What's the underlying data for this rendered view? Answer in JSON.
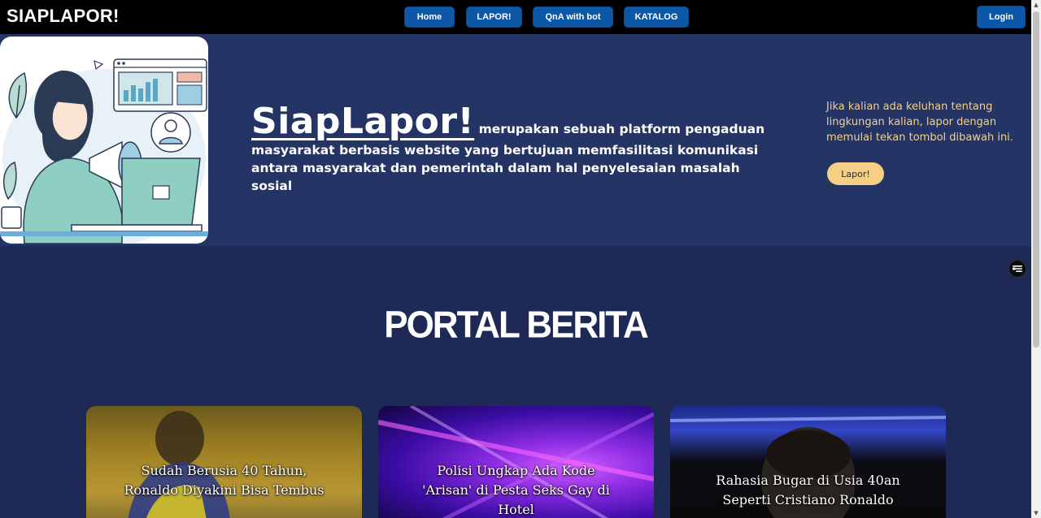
{
  "nav": {
    "brand": "SIAPLAPOR!",
    "items": [
      {
        "label": "Home"
      },
      {
        "label": "LAPOR!"
      },
      {
        "label": "QnA with bot"
      },
      {
        "label": "KATALOG"
      }
    ],
    "login_label": "Login"
  },
  "hero": {
    "title": "SiapLapor!",
    "description": "merupakan sebuah platform pengaduan masyarakat berbasis website yang bertujuan memfasilitasi komunikasi antara masyarakat dan pemerintah dalam hal penyelesaian masalah sosial",
    "side_text": "Jika kalian ada keluhan tentang lingkungan kalian, lapor dengan memulai tekan tombol dibawah ini.",
    "cta_label": "Lapor!"
  },
  "portal": {
    "title": "PORTAL BERITA",
    "cards": [
      {
        "title": "Sudah Berusia 40 Tahun, Ronaldo Diyakini Bisa Tembus"
      },
      {
        "title": "Polisi Ungkap Ada Kode 'Arisan' di Pesta Seks Gay di Hotel"
      },
      {
        "title": "Rahasia Bugar di Usia 40an Seperti Cristiano Ronaldo"
      }
    ]
  },
  "colors": {
    "navbar": "#000000",
    "nav_button": "#0d57a8",
    "hero_bg": "#243565",
    "page_bg": "#1e2a55",
    "accent": "#f6cf87"
  }
}
